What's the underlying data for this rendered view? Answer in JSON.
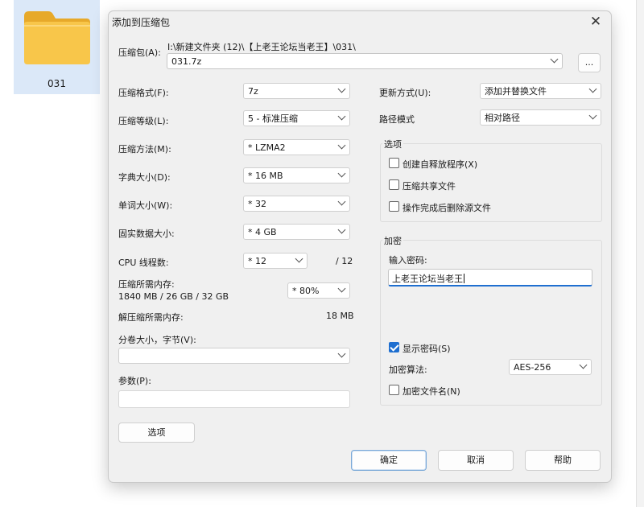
{
  "desktop": {
    "folder_label": "031"
  },
  "dialog": {
    "title": "添加到压缩包",
    "archive_label": "压缩包(A):",
    "archive_path": "I:\\新建文件夹 (12)\\【上老王论坛当老王】\\031\\",
    "archive_name": "031.7z",
    "browse_label": "...",
    "left": {
      "format_label": "压缩格式(F):",
      "format_value": "7z",
      "level_label": "压缩等级(L):",
      "level_value": "5 - 标准压缩",
      "method_label": "压缩方法(M):",
      "method_value": "* LZMA2",
      "dict_label": "字典大小(D):",
      "dict_value": "* 16 MB",
      "word_label": "单词大小(W):",
      "word_value": "* 32",
      "solid_label": "固实数据大小:",
      "solid_value": "* 4 GB",
      "threads_label": "CPU 线程数:",
      "threads_value": "* 12",
      "threads_total": "/ 12",
      "mem_comp_label": "压缩所需内存:",
      "mem_comp_detail": "1840 MB / 26 GB / 32 GB",
      "mem_comp_value": "* 80%",
      "mem_decomp_label": "解压缩所需内存:",
      "mem_decomp_value": "18 MB",
      "split_label": "分卷大小，字节(V):",
      "split_value": "",
      "params_label": "参数(P):",
      "params_value": "",
      "options_button": "选项"
    },
    "right": {
      "update_label": "更新方式(U):",
      "update_value": "添加并替换文件",
      "path_label": "路径模式",
      "path_value": "相对路径",
      "options_group": "选项",
      "opt_sfx": "创建自释放程序(X)",
      "opt_shared": "压缩共享文件",
      "opt_delete": "操作完成后删除源文件",
      "encrypt_group": "加密",
      "password_label": "输入密码:",
      "password_value": "上老王论坛当老王",
      "show_password": "显示密码(S)",
      "algorithm_label": "加密算法:",
      "algorithm_value": "AES-256",
      "encrypt_names": "加密文件名(N)"
    },
    "buttons": {
      "ok": "确定",
      "cancel": "取消",
      "help": "帮助"
    }
  }
}
